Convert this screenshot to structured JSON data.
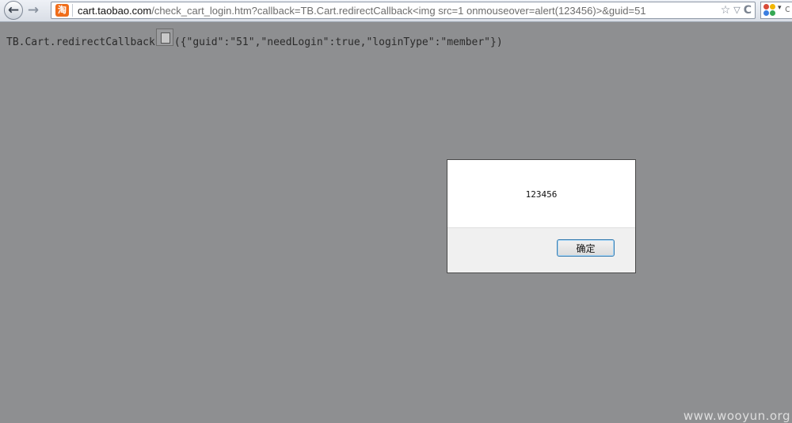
{
  "browser": {
    "url_domain": "cart.taobao.com",
    "url_rest": "/check_cart_login.htm?callback=TB.Cart.redirectCallback<img src=1 onmouseover=alert(123456)>&guid=51",
    "site_icon_glyph": "淘",
    "back_glyph": "←",
    "forward_glyph": "→",
    "star_glyph": "☆",
    "dropdown_glyph": "▽",
    "reload_glyph": "C",
    "search_dropdown_glyph": "▾",
    "search_extra_glyph": "c"
  },
  "page": {
    "callback_before": "TB.Cart.redirectCallback",
    "callback_after": "({\"guid\":\"51\",\"needLogin\":true,\"loginType\":\"member\"})"
  },
  "dialog": {
    "message": "123456",
    "ok_label": "确定"
  },
  "watermark": "www.wooyun.org",
  "colors": {
    "page_background": "#8e8f91",
    "site_icon": "#f06d1a",
    "ok_button_border": "#3c7fb1"
  },
  "icons": {
    "back": "back-arrow-icon",
    "forward": "forward-arrow-icon",
    "site": "taobao-favicon-icon",
    "bookmark": "star-icon",
    "history": "dropdown-icon",
    "reload": "reload-icon",
    "search_engine": "google-icon",
    "broken_image": "broken-image-icon"
  }
}
